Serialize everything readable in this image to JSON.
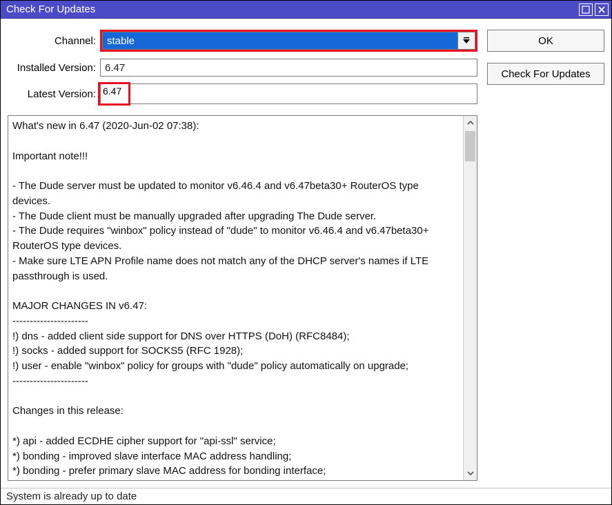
{
  "window": {
    "title": "Check For Updates"
  },
  "labels": {
    "channel": "Channel:",
    "installed": "Installed Version:",
    "latest": "Latest Version:"
  },
  "fields": {
    "channel_value": "stable",
    "installed_version": "6.47",
    "latest_version": "6.47"
  },
  "buttons": {
    "ok": "OK",
    "check": "Check For Updates"
  },
  "changelog": "What's new in 6.47 (2020-Jun-02 07:38):\n\nImportant note!!!\n\n- The Dude server must be updated to monitor v6.46.4 and v6.47beta30+ RouterOS type devices.\n- The Dude client must be manually upgraded after upgrading The Dude server.\n- The Dude requires \"winbox\" policy instead of \"dude\" to monitor v6.46.4 and v6.47beta30+ RouterOS type devices.\n- Make sure LTE APN Profile name does not match any of the DHCP server's names if LTE passthrough is used.\n\nMAJOR CHANGES IN v6.47:\n----------------------\n!) dns - added client side support for DNS over HTTPS (DoH) (RFC8484);\n!) socks - added support for SOCKS5 (RFC 1928);\n!) user - enable \"winbox\" policy for groups with \"dude\" policy automatically on upgrade;\n----------------------\n\nChanges in this release:\n\n*) api - added ECDHE cipher support for \"api-ssl\" service;\n*) bonding - improved slave interface MAC address handling;\n*) bonding - prefer primary slave MAC address for bonding interface;\n*) branding - do not ask to confirm configuration applied from branding package;",
  "status": "System is already up to date"
}
